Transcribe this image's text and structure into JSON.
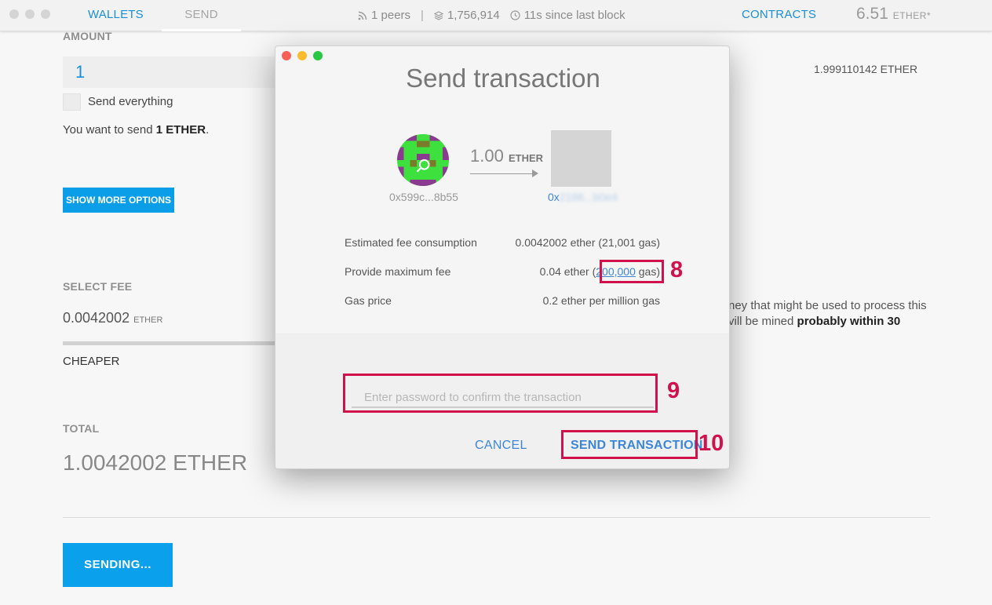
{
  "topbar": {
    "tabs": {
      "wallets": "WALLETS",
      "send": "SEND",
      "contracts": "CONTRACTS"
    },
    "status": {
      "peers": "1 peers",
      "block": "1,756,914",
      "since": "11s since last block"
    },
    "balance": {
      "amount": "6.51",
      "unit": "ETHER*"
    }
  },
  "form": {
    "amount_label": "AMOUNT",
    "amount_value": "1",
    "send_everything": "Send everything",
    "you_want_prefix": "You want to send ",
    "you_want_amount": "1 ETHER",
    "you_want_suffix": ".",
    "balance_right": "1.999110142 ETHER",
    "show_more_options": "SHOW MORE OPTIONS",
    "select_fee_label": "SELECT FEE",
    "fee_value": "0.0042002",
    "fee_unit": "ETHER",
    "fee_slider_level": 0.25,
    "cheaper_label": "CHEAPER",
    "fee_desc_line1": "ney that might be used to process this",
    "fee_desc_line2_prefix": "vill be mined ",
    "fee_desc_line2_bold": "probably within 30",
    "total_label": "TOTAL",
    "total_value": "1.0042002 ETHER",
    "sending_button": "SENDING..."
  },
  "modal": {
    "title": "Send transaction",
    "from_address": "0x599c...8b55",
    "amount": "1.00",
    "amount_unit": "ETHER",
    "to_address_prefix": "0x",
    "to_address_blurred": "2186...b0e4",
    "rows": [
      {
        "label": "Estimated fee consumption",
        "value": "0.0042002 ether (21,001 gas)"
      },
      {
        "label": "Provide maximum fee",
        "value_prefix": "0.04 ether (",
        "value_link": "200,000",
        "value_suffix": " gas)"
      },
      {
        "label": "Gas price",
        "value": "0.2 ether per million gas"
      }
    ],
    "password_placeholder": "Enter password to confirm the transaction",
    "cancel_button": "CANCEL",
    "send_button": "SEND TRANSACTION"
  },
  "annotations": [
    "8",
    "9",
    "10"
  ],
  "colors": {
    "accent_blue": "#1a8fd6",
    "button_blue": "#0a9ee8",
    "callout_red": "#d0114c",
    "identicon_green": "#3ee03e",
    "identicon_purple": "#8a3b8f"
  },
  "icons": {
    "peers": "rss-icon",
    "block": "layers-icon",
    "since": "clock-icon",
    "identicon": "identicon-avatar"
  }
}
